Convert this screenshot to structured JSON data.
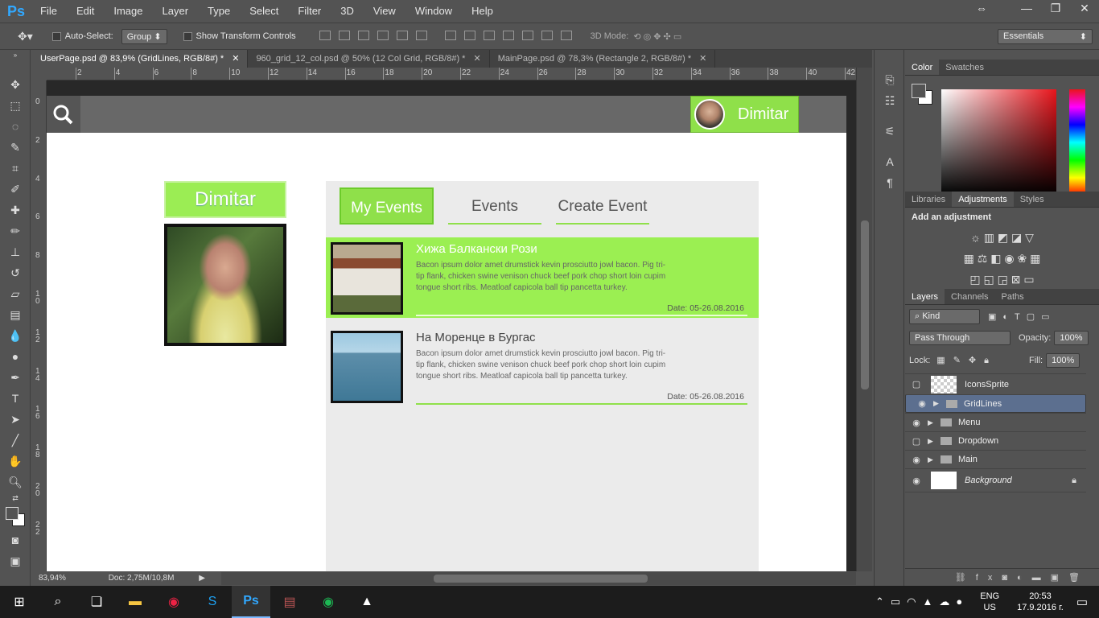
{
  "menubar": {
    "logo": "Ps",
    "items": [
      "File",
      "Edit",
      "Image",
      "Layer",
      "Type",
      "Select",
      "Filter",
      "3D",
      "View",
      "Window",
      "Help"
    ]
  },
  "options": {
    "auto_select": "Auto-Select:",
    "group": "Group",
    "transform": "Show Transform Controls",
    "mode3d": "3D Mode:",
    "workspace": "Essentials"
  },
  "tabs": [
    "UserPage.psd @ 83,9% (GridLines, RGB/8#) *",
    "960_grid_12_col.psd @ 50% (12 Col Grid, RGB/8#) *",
    "MainPage.psd @ 78,3% (Rectangle 2, RGB/8#) *"
  ],
  "ruler_h": [
    "2",
    "4",
    "6",
    "8",
    "10",
    "12",
    "14",
    "16",
    "18",
    "20",
    "22",
    "24",
    "26",
    "28",
    "30",
    "32",
    "34",
    "36",
    "38",
    "40",
    "42"
  ],
  "ruler_v": [
    "0",
    "2",
    "4",
    "6",
    "8",
    "1\n0",
    "1\n2",
    "1\n4",
    "1\n6",
    "1\n8",
    "2\n0",
    "2\n2"
  ],
  "site": {
    "user_name": "Dimitar",
    "profile_name": "Dimitar",
    "tabs": {
      "my": "My Events",
      "events": "Events",
      "create": "Create Event"
    },
    "events": [
      {
        "title": "Хижа Балкански Рози",
        "desc": "Bacon ipsum dolor amet drumstick kevin prosciutto jowl bacon. Pig tri-tip flank, chicken swine venison chuck beef pork chop short loin cupim tongue short ribs. Meatloaf capicola ball tip pancetta turkey.",
        "date": "Date: 05-26.08.2016"
      },
      {
        "title": "На Моренце в Бургас",
        "desc": "Bacon ipsum dolor amet drumstick kevin prosciutto jowl bacon. Pig tri-tip flank, chicken swine venison chuck beef pork chop short loin cupim tongue short ribs. Meatloaf capicola ball tip pancetta turkey.",
        "date": "Date: 05-26.08.2016"
      }
    ]
  },
  "status": {
    "zoom": "83,94%",
    "doc": "Doc: 2,75M/10,8M"
  },
  "panels": {
    "color_tabs": [
      "Color",
      "Swatches"
    ],
    "adj_tabs": [
      "Libraries",
      "Adjustments",
      "Styles"
    ],
    "adj_title": "Add an adjustment",
    "layer_tabs": [
      "Layers",
      "Channels",
      "Paths"
    ],
    "kind": "Kind",
    "blend": "Pass Through",
    "opacity_label": "Opacity:",
    "opacity": "100%",
    "lock": "Lock:",
    "fill_label": "Fill:",
    "fill": "100%",
    "layers": [
      "IconsSprite",
      "GridLines",
      "Menu",
      "Dropdown",
      "Main",
      "Background"
    ]
  },
  "taskbar": {
    "lang": "ENG",
    "layout": "US",
    "time": "20:53",
    "date": "17.9.2016 г."
  }
}
